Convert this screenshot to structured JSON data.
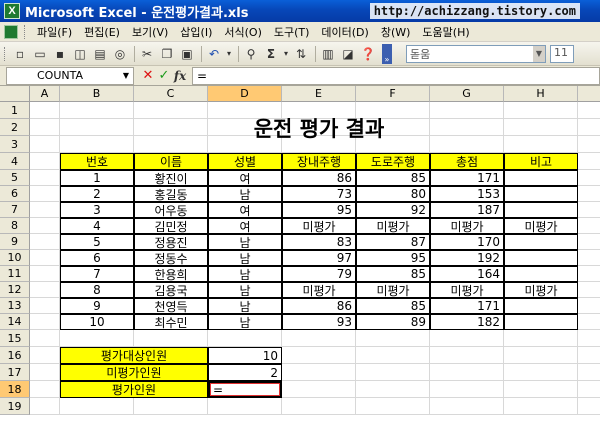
{
  "window": {
    "title": "Microsoft Excel - 운전평가결과.xls",
    "app_icon_letter": "X",
    "watermark": "http://achizzang.tistory.com"
  },
  "menu": [
    "파일(F)",
    "편집(E)",
    "보기(V)",
    "삽입(I)",
    "서식(O)",
    "도구(T)",
    "데이터(D)",
    "창(W)",
    "도움말(H)"
  ],
  "toolbar": {
    "autosum_label": "Σ",
    "font_placeholder": "돋움",
    "size_value": "11"
  },
  "formula_bar": {
    "name_box": "COUNTA",
    "cancel": "✕",
    "enter": "✓",
    "fx": "fx",
    "formula": "="
  },
  "columns": [
    "A",
    "B",
    "C",
    "D",
    "E",
    "F",
    "G",
    "H"
  ],
  "rows": [
    "1",
    "2",
    "3",
    "4",
    "5",
    "6",
    "7",
    "8",
    "9",
    "10",
    "11",
    "12",
    "13",
    "14",
    "15",
    "16",
    "17",
    "18",
    "19"
  ],
  "sheet": {
    "title": "운전 평가 결과",
    "headers": [
      "번호",
      "이름",
      "성별",
      "장내주행",
      "도로주행",
      "총점",
      "비고"
    ],
    "records": [
      [
        "1",
        "황진이",
        "여",
        "86",
        "85",
        "171",
        ""
      ],
      [
        "2",
        "홍길동",
        "남",
        "73",
        "80",
        "153",
        ""
      ],
      [
        "3",
        "어우동",
        "여",
        "95",
        "92",
        "187",
        ""
      ],
      [
        "4",
        "김민정",
        "여",
        "미평가",
        "미평가",
        "미평가",
        "미평가"
      ],
      [
        "5",
        "정용진",
        "남",
        "83",
        "87",
        "170",
        ""
      ],
      [
        "6",
        "정동수",
        "남",
        "97",
        "95",
        "192",
        ""
      ],
      [
        "7",
        "한용희",
        "남",
        "79",
        "85",
        "164",
        ""
      ],
      [
        "8",
        "김용국",
        "남",
        "미평가",
        "미평가",
        "미평가",
        "미평가"
      ],
      [
        "9",
        "천영득",
        "남",
        "86",
        "85",
        "171",
        ""
      ],
      [
        "10",
        "최수민",
        "남",
        "93",
        "89",
        "182",
        ""
      ]
    ],
    "summary": [
      {
        "label": "평가대상인원",
        "value": "10"
      },
      {
        "label": "미평가인원",
        "value": "2"
      },
      {
        "label": "평가인원",
        "value": "="
      }
    ]
  }
}
